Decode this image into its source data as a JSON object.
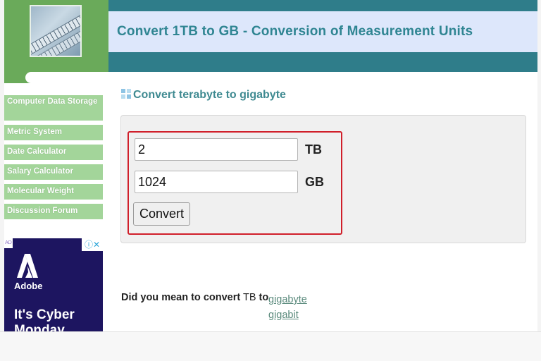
{
  "header": {
    "title": "Convert 1TB to GB - Conversion of Measurement Units"
  },
  "sidebar": {
    "items": [
      {
        "label": "Computer Data Storage"
      },
      {
        "label": "Metric System"
      },
      {
        "label": "Date Calculator"
      },
      {
        "label": "Salary Calculator"
      },
      {
        "label": "Molecular Weight"
      },
      {
        "label": "Discussion Forum"
      }
    ]
  },
  "ad": {
    "badge": "AD",
    "controls": "ⓘ✕",
    "brand": "Adobe",
    "headline": "It's Cyber Monday"
  },
  "main": {
    "heading": "Convert terabyte to gigabyte",
    "converter": {
      "input_value": "2",
      "input_unit": "TB",
      "output_value": "1024",
      "output_unit": "GB",
      "button_label": "Convert"
    },
    "suggestion": {
      "prefix": "Did you mean to convert",
      "unit": "TB",
      "to": "to",
      "options": [
        "gigabyte",
        "gigabit"
      ]
    }
  },
  "colors": {
    "header_band": "#2f7d8a",
    "title_bar": "#dde7fb",
    "title_text": "#2f8592",
    "sidebar_item": "#a3d59a",
    "highlight_border": "#d01f2a"
  }
}
